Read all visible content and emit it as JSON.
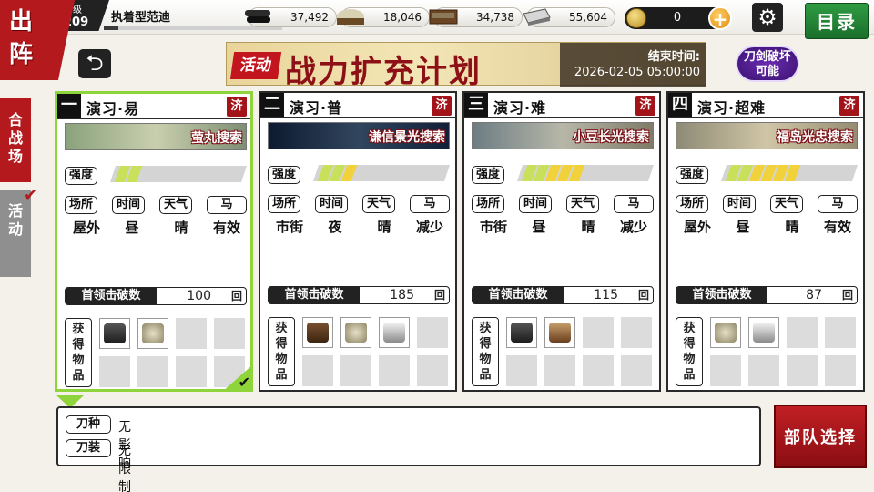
{
  "header": {
    "title_line1": "出",
    "title_line2": "阵",
    "level_label": "等级",
    "level_value": "209",
    "player_name": "执着型范迪",
    "exp_progress": 0.08,
    "resources": [
      {
        "icon": "charcoal-icon",
        "value": "37,492"
      },
      {
        "icon": "whetstone-icon",
        "value": "18,046"
      },
      {
        "icon": "cooling-material-icon",
        "value": "34,738"
      },
      {
        "icon": "steel-icon",
        "value": "55,604"
      }
    ],
    "koban": "0",
    "menu_label": "目录"
  },
  "banner": {
    "tag": "活动",
    "title": "战力扩充计划",
    "end_label": "结束时间:",
    "end_time": "2026-02-05 05:00:00",
    "badge_line1": "刀剑破坏",
    "badge_line2": "可能"
  },
  "side_tabs": [
    {
      "label_1": "合",
      "label_2": "战",
      "label_3": "场"
    },
    {
      "label_1": "活",
      "label_2": "动"
    }
  ],
  "labels": {
    "strength": "强度",
    "terrain": "场所",
    "time": "时间",
    "weather": "天气",
    "horse": "马",
    "boss_kills": "首领击破数",
    "boss_unit": "回",
    "items_1": "获",
    "items_2": "得",
    "items_3": "物",
    "items_4": "品",
    "done": "济"
  },
  "cards": [
    {
      "num": "一",
      "title": "演习·易",
      "sword": "萤丸搜索",
      "strength_level": 2,
      "strength_max": 10,
      "terrain": "屋外",
      "time": "昼",
      "weather": "晴",
      "horse": "有效",
      "boss_kills": "100",
      "items": [
        "charcoal",
        "whetstone"
      ],
      "selected": true
    },
    {
      "num": "二",
      "title": "演习·普",
      "sword": "谦信景光搜索",
      "strength_level": 3,
      "strength_max": 10,
      "terrain": "市街",
      "time": "夜",
      "weather": "晴",
      "horse": "减少",
      "boss_kills": "185",
      "items": [
        "talisman",
        "whetstone",
        "steel"
      ],
      "selected": false
    },
    {
      "num": "三",
      "title": "演习·难",
      "sword": "小豆长光搜索",
      "strength_level": 5,
      "strength_max": 10,
      "terrain": "市街",
      "time": "昼",
      "weather": "晴",
      "horse": "减少",
      "boss_kills": "115",
      "items": [
        "charcoal",
        "cooling"
      ],
      "selected": false
    },
    {
      "num": "四",
      "title": "演习·超难",
      "sword": "福岛光忠搜索",
      "strength_level": 6,
      "strength_max": 10,
      "terrain": "屋外",
      "time": "昼",
      "weather": "晴",
      "horse": "有效",
      "boss_kills": "87",
      "items": [
        "whetstone",
        "steel"
      ],
      "selected": false
    }
  ],
  "bottom": {
    "sword_type_label": "刀种",
    "sword_type_value": "无影响",
    "equip_label": "刀装",
    "equip_value": "无限制"
  },
  "squad_button": "部队选择",
  "colors": {
    "accent_red": "#b3191d",
    "selected_green": "#8fd43a",
    "strength_yellow": "#f2d23a",
    "strength_green": "#c8e05a"
  }
}
